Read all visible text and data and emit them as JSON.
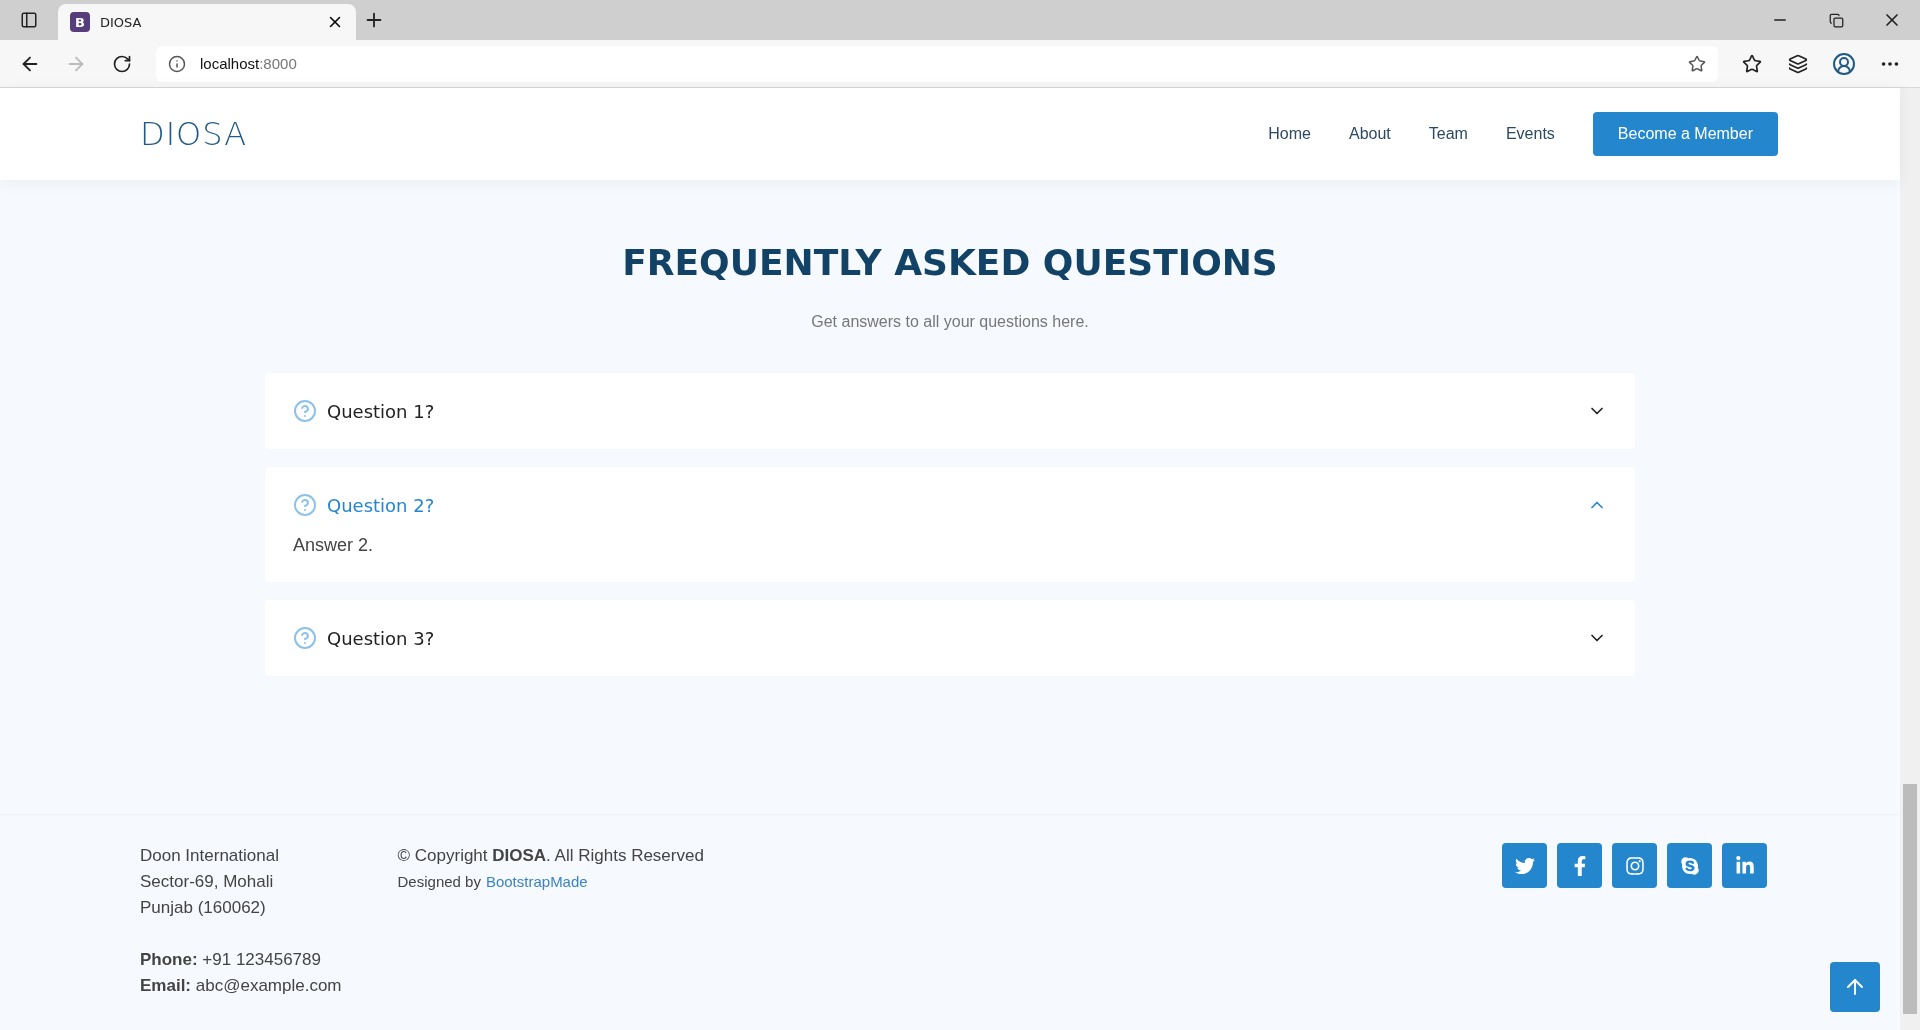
{
  "browser": {
    "tab_title": "DIOSA",
    "tab_icon_letter": "B",
    "url_host": "localhost",
    "url_port": ":8000"
  },
  "header": {
    "logo": "DIOSA",
    "nav": [
      {
        "label": "Home"
      },
      {
        "label": "About"
      },
      {
        "label": "Team"
      },
      {
        "label": "Events"
      }
    ],
    "cta": "Become a Member"
  },
  "faq": {
    "title": "FREQUENTLY ASKED QUESTIONS",
    "subtitle": "Get answers to all your questions here.",
    "items": [
      {
        "question": "Question 1?",
        "expanded": false
      },
      {
        "question": "Question 2?",
        "expanded": true,
        "answer": "Answer 2."
      },
      {
        "question": "Question 3?",
        "expanded": false
      }
    ]
  },
  "footer": {
    "address_lines": [
      "Doon International",
      "Sector-69, Mohali",
      "Punjab (160062)"
    ],
    "phone": "**Phone:** +91 123456789",
    "email": "**Email:** abc@example.com",
    "copyright": "© Copyright **DIOSA**. All Rights Reserved",
    "designed_by": "Designed by",
    "designer_link": "BootstrapMade",
    "socials": [
      {
        "kind": "twitter"
      },
      {
        "kind": "facebook"
      },
      {
        "kind": "instagram"
      },
      {
        "kind": "skype"
      },
      {
        "kind": "linkedin"
      }
    ]
  }
}
